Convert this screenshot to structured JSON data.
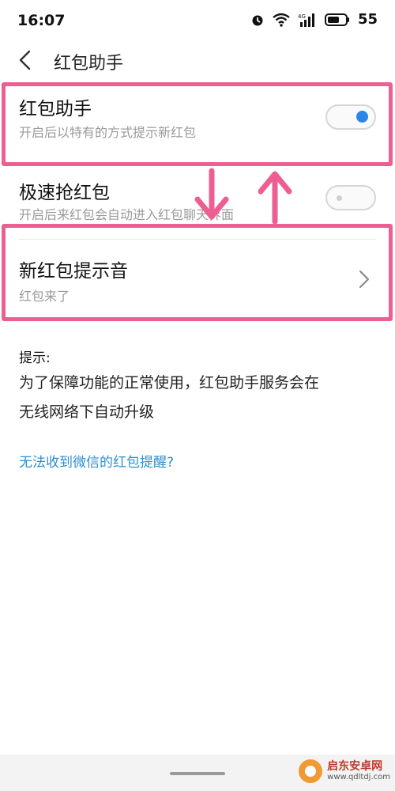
{
  "status_bar": {
    "time": "16:07",
    "network_label": "4G",
    "battery": "55"
  },
  "nav": {
    "title": "红包助手"
  },
  "settings": [
    {
      "title": "红包助手",
      "subtitle": "开启后以特有的方式提示新红包",
      "toggle_on": true
    },
    {
      "title": "极速抢红包",
      "subtitle": "开启后来红包会自动进入红包聊天界面",
      "toggle_on": false
    },
    {
      "title": "新红包提示音",
      "subtitle": "红包来了",
      "has_chevron": true
    }
  ],
  "hint": {
    "label": "提示:",
    "line1": "为了保障功能的正常使用，红包助手服务会在",
    "line2": "无线网络下自动升级"
  },
  "help_link": "无法收到微信的红包提醒?",
  "watermark": {
    "name": "启东安卓网",
    "url": "www.qdltdj.com"
  },
  "colors": {
    "accent": "#2b86e6",
    "highlight": "#ec5f93",
    "link": "#2d8fd0"
  }
}
